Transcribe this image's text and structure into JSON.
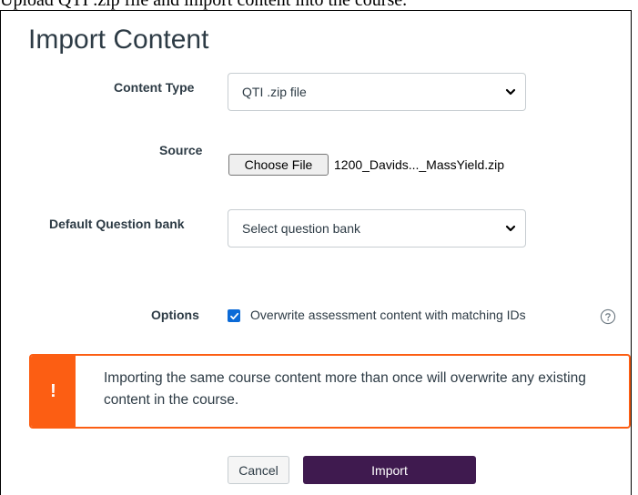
{
  "top_strip_text": "Upload QTI .zip file and import content into the course.",
  "title": "Import Content",
  "form": {
    "content_type": {
      "label": "Content Type",
      "value": "QTI .zip file"
    },
    "source": {
      "label": "Source",
      "button_label": "Choose File",
      "file_name": "1200_Davids..._MassYield.zip"
    },
    "question_bank": {
      "label": "Default Question bank",
      "value": "Select question bank"
    },
    "options": {
      "label": "Options",
      "checkbox_label": "Overwrite assessment content with matching IDs",
      "checked": true
    }
  },
  "alert": {
    "icon": "!",
    "message": "Importing the same course content more than once will overwrite any existing content in the course.",
    "color": "#fc5e13"
  },
  "buttons": {
    "cancel": "Cancel",
    "import": "Import"
  },
  "colors": {
    "primary": "#3f1a4f",
    "checkbox": "#0b6ad7",
    "warning": "#fc5e13"
  },
  "icons": {
    "select_chevron": "chevron-down-icon",
    "help": "question-circle-icon",
    "checkmark": "check-icon"
  }
}
